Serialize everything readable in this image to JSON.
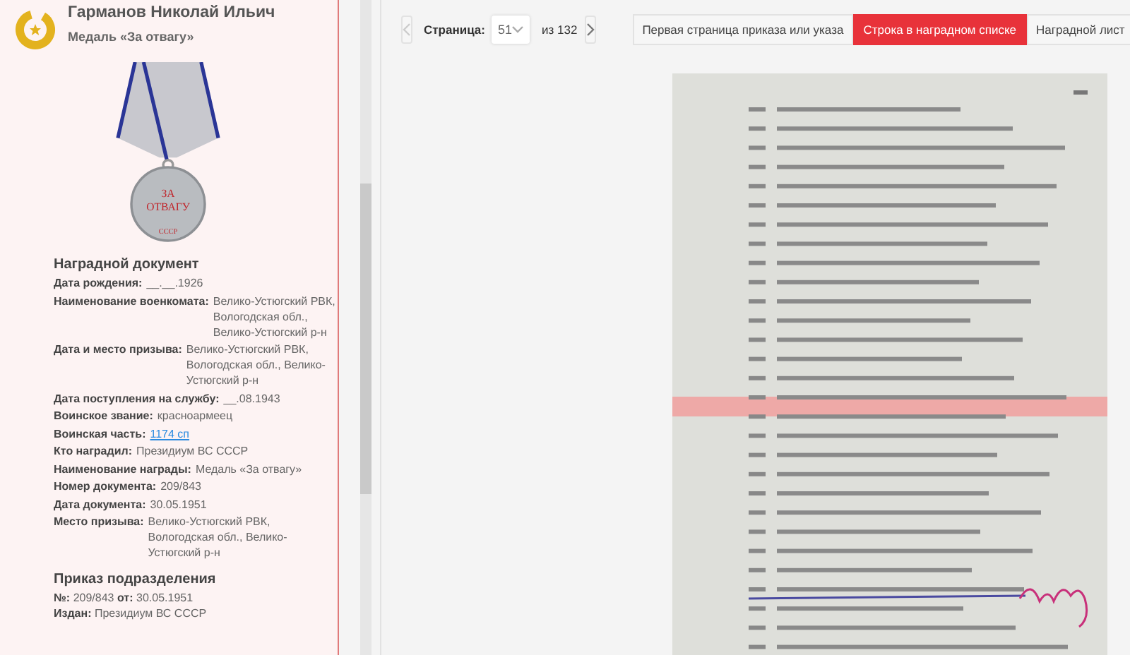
{
  "header": {
    "name": "Гарманов Николай Ильич",
    "award": "Медаль «За отвагу»"
  },
  "medal": {
    "line_1": "ЗА",
    "line_2": "ОТВАГУ",
    "line_3": "СССР"
  },
  "award_document": {
    "title": "Наградной документ",
    "fields": [
      {
        "label": "Дата рождения:",
        "value": "__.__.1926",
        "kind": "text"
      },
      {
        "label": "Наименование военкомата:",
        "value": "Велико-Устюгский РВК, Вологодская обл., Велико-Устюгский р-н",
        "kind": "text"
      },
      {
        "label": "Дата и место призыва:",
        "value": "Велико-Устюгский РВК, Вологодская обл., Велико-Устюгский р-н",
        "kind": "text"
      },
      {
        "label": "Дата поступления на службу:",
        "value": "__.08.1943",
        "kind": "text"
      },
      {
        "label": "Воинское звание:",
        "value": "красноармеец",
        "kind": "text"
      },
      {
        "label": "Воинская часть:",
        "value": "1174 сп",
        "kind": "link"
      },
      {
        "label": "Кто наградил:",
        "value": "Президиум ВС СССР",
        "kind": "text"
      },
      {
        "label": "Наименование награды:",
        "value": "Медаль «За отвагу»",
        "kind": "text"
      },
      {
        "label": "Номер документа:",
        "value": "209/843",
        "kind": "text"
      },
      {
        "label": "Дата документа:",
        "value": "30.05.1951",
        "kind": "text"
      },
      {
        "label": "Место призыва:",
        "value": "Велико-Устюгский РВК, Вологодская обл., Велико-Устюгский р-н",
        "kind": "text"
      }
    ]
  },
  "unit_order": {
    "title": "Приказ подразделения",
    "number_label": "№:",
    "number": "209/843",
    "date_label": "от:",
    "date": "30.05.1951",
    "issued_label": "Издан:",
    "issued": "Президиум ВС СССР"
  },
  "pager": {
    "label": "Страница:",
    "page": "51",
    "total": "из 132",
    "prev_disabled": true,
    "next_disabled": false
  },
  "tabs": [
    {
      "label": "Первая страница приказа или указа",
      "selected": false
    },
    {
      "label": "Строка в наградном списке",
      "selected": true
    },
    {
      "label": "Наградной лист",
      "selected": false
    }
  ]
}
